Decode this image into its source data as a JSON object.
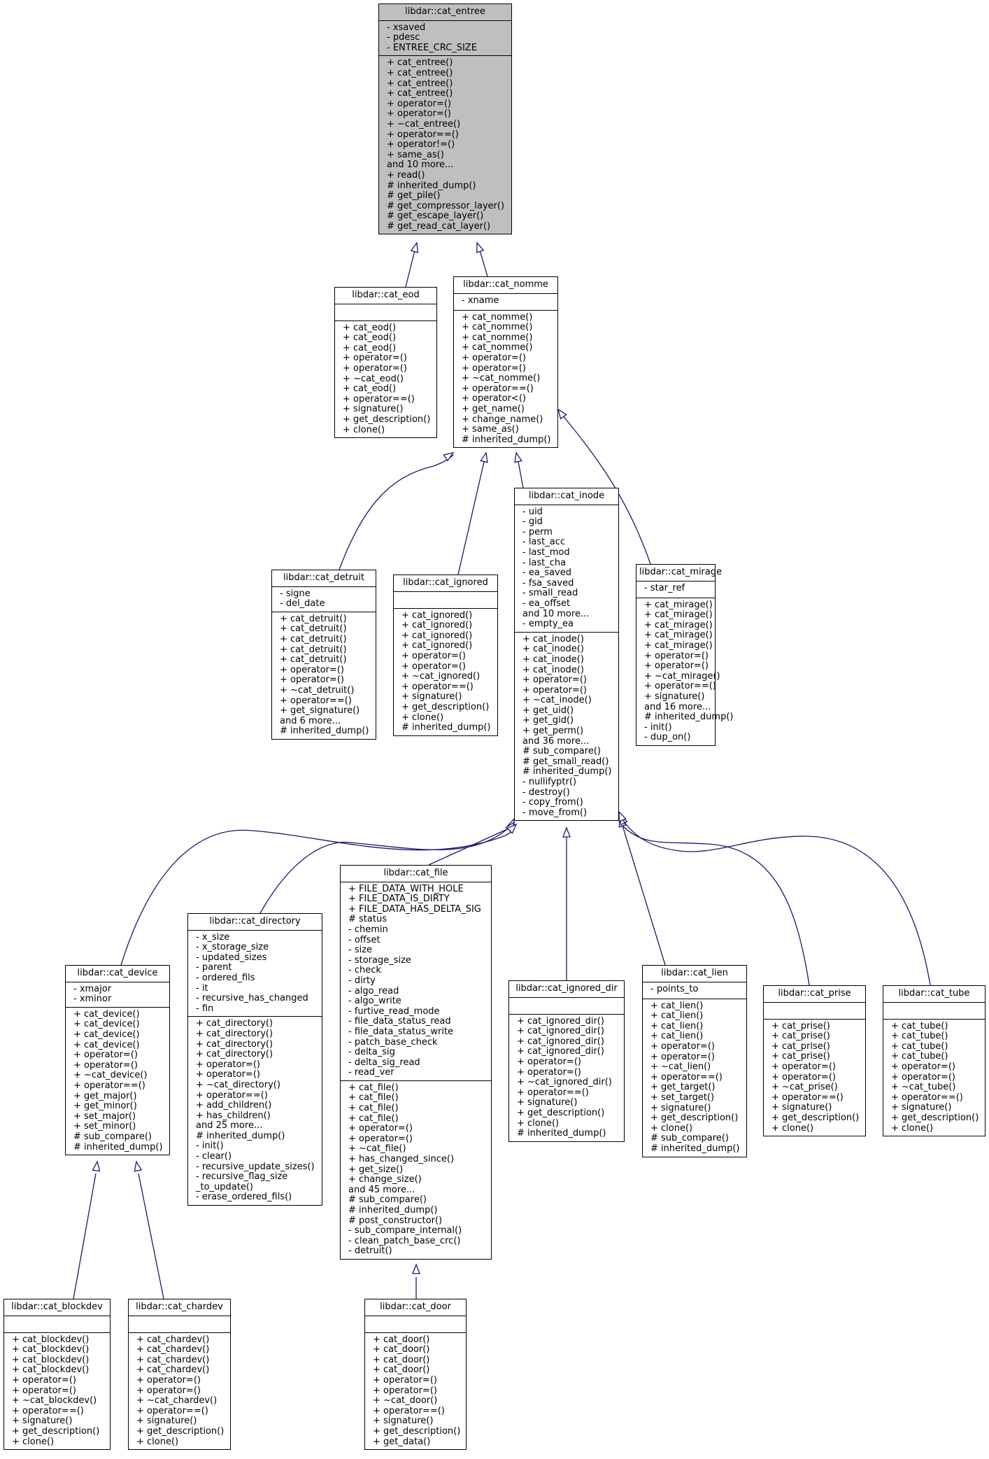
{
  "diagram": {
    "type": "class-inheritance",
    "nodes": [
      {
        "id": "cat_entree",
        "title": "libdar::cat_entree",
        "highlighted": true,
        "attributes": [
          "- xsaved",
          "- pdesc",
          "- ENTREE_CRC_SIZE"
        ],
        "methods": [
          "+ cat_entree()",
          "+ cat_entree()",
          "+ cat_entree()",
          "+ cat_entree()",
          "+ operator=()",
          "+ operator=()",
          "+ ~cat_entree()",
          "+ operator==()",
          "+ operator!=()",
          "+ same_as()",
          "and 10 more...",
          "+ read()",
          "# inherited_dump()",
          "# get_pile()",
          "# get_compressor_layer()",
          "# get_escape_layer()",
          "# get_read_cat_layer()"
        ]
      },
      {
        "id": "cat_eod",
        "title": "libdar::cat_eod",
        "attributes": [],
        "methods": [
          "+ cat_eod()",
          "+ cat_eod()",
          "+ cat_eod()",
          "+ operator=()",
          "+ operator=()",
          "+ ~cat_eod()",
          "+ cat_eod()",
          "+ operator==()",
          "+ signature()",
          "+ get_description()",
          "+ clone()"
        ]
      },
      {
        "id": "cat_nomme",
        "title": "libdar::cat_nomme",
        "attributes": [
          "- xname"
        ],
        "methods": [
          "+ cat_nomme()",
          "+ cat_nomme()",
          "+ cat_nomme()",
          "+ cat_nomme()",
          "+ operator=()",
          "+ operator=()",
          "+ ~cat_nomme()",
          "+ operator==()",
          "+ operator<()",
          "+ get_name()",
          "+ change_name()",
          "+ same_as()",
          "# inherited_dump()"
        ]
      },
      {
        "id": "cat_detruit",
        "title": "libdar::cat_detruit",
        "attributes": [
          "- signe",
          "- del_date"
        ],
        "methods": [
          "+ cat_detruit()",
          "+ cat_detruit()",
          "+ cat_detruit()",
          "+ cat_detruit()",
          "+ cat_detruit()",
          "+ operator=()",
          "+ operator=()",
          "+ ~cat_detruit()",
          "+ operator==()",
          "+ get_signature()",
          "and 6 more...",
          "# inherited_dump()"
        ]
      },
      {
        "id": "cat_ignored",
        "title": "libdar::cat_ignored",
        "attributes": [],
        "methods": [
          "+ cat_ignored()",
          "+ cat_ignored()",
          "+ cat_ignored()",
          "+ cat_ignored()",
          "+ operator=()",
          "+ operator=()",
          "+ ~cat_ignored()",
          "+ operator==()",
          "+ signature()",
          "+ get_description()",
          "+ clone()",
          "# inherited_dump()"
        ]
      },
      {
        "id": "cat_inode",
        "title": "libdar::cat_inode",
        "attributes": [
          "- uid",
          "- gid",
          "- perm",
          "- last_acc",
          "- last_mod",
          "- last_cha",
          "- ea_saved",
          "- fsa_saved",
          "- small_read",
          "- ea_offset",
          "and 10 more...",
          "- empty_ea"
        ],
        "methods": [
          "+ cat_inode()",
          "+ cat_inode()",
          "+ cat_inode()",
          "+ cat_inode()",
          "+ operator=()",
          "+ operator=()",
          "+ ~cat_inode()",
          "+ get_uid()",
          "+ get_gid()",
          "+ get_perm()",
          "and 36 more...",
          "# sub_compare()",
          "# get_small_read()",
          "# inherited_dump()",
          "- nullifyptr()",
          "- destroy()",
          "- copy_from()",
          "- move_from()"
        ]
      },
      {
        "id": "cat_mirage",
        "title": "libdar::cat_mirage",
        "attributes": [
          "- star_ref"
        ],
        "methods": [
          "+ cat_mirage()",
          "+ cat_mirage()",
          "+ cat_mirage()",
          "+ cat_mirage()",
          "+ cat_mirage()",
          "+ operator=()",
          "+ operator=()",
          "+ ~cat_mirage()",
          "+ operator==()",
          "+ signature()",
          "and 16 more...",
          "# inherited_dump()",
          "- init()",
          "- dup_on()"
        ]
      },
      {
        "id": "cat_device",
        "title": "libdar::cat_device",
        "attributes": [
          "- xmajor",
          "- xminor"
        ],
        "methods": [
          "+ cat_device()",
          "+ cat_device()",
          "+ cat_device()",
          "+ cat_device()",
          "+ operator=()",
          "+ operator=()",
          "+ ~cat_device()",
          "+ operator==()",
          "+ get_major()",
          "+ get_minor()",
          "+ set_major()",
          "+ set_minor()",
          "# sub_compare()",
          "# inherited_dump()"
        ]
      },
      {
        "id": "cat_directory",
        "title": "libdar::cat_directory",
        "attributes": [
          "- x_size",
          "- x_storage_size",
          "- updated_sizes",
          "- parent",
          "- ordered_fils",
          "- it",
          "- recursive_has_changed",
          "- fin"
        ],
        "methods": [
          "+ cat_directory()",
          "+ cat_directory()",
          "+ cat_directory()",
          "+ cat_directory()",
          "+ operator=()",
          "+ operator=()",
          "+ ~cat_directory()",
          "+ operator==()",
          "+ add_children()",
          "+ has_children()",
          "and 25 more...",
          "# inherited_dump()",
          "- init()",
          "- clear()",
          "- recursive_update_sizes()",
          "- recursive_flag_size",
          "_to_update()",
          "- erase_ordered_fils()"
        ]
      },
      {
        "id": "cat_file",
        "title": "libdar::cat_file",
        "attributes": [
          "+ FILE_DATA_WITH_HOLE",
          "+ FILE_DATA_IS_DIRTY",
          "+ FILE_DATA_HAS_DELTA_SIG",
          "# status",
          "- chemin",
          "- offset",
          "- size",
          "- storage_size",
          "- check",
          "- dirty",
          "- algo_read",
          "- algo_write",
          "- furtive_read_mode",
          "- file_data_status_read",
          "- file_data_status_write",
          "- patch_base_check",
          "- delta_sig",
          "- delta_sig_read",
          "- read_ver"
        ],
        "methods": [
          "+ cat_file()",
          "+ cat_file()",
          "+ cat_file()",
          "+ cat_file()",
          "+ operator=()",
          "+ operator=()",
          "+ ~cat_file()",
          "+ has_changed_since()",
          "+ get_size()",
          "+ change_size()",
          "and 45 more...",
          "# sub_compare()",
          "# inherited_dump()",
          "# post_constructor()",
          "- sub_compare_internal()",
          "- clean_patch_base_crc()",
          "- detruit()"
        ]
      },
      {
        "id": "cat_ignored_dir",
        "title": "libdar::cat_ignored_dir",
        "attributes": [],
        "methods": [
          "+ cat_ignored_dir()",
          "+ cat_ignored_dir()",
          "+ cat_ignored_dir()",
          "+ cat_ignored_dir()",
          "+ operator=()",
          "+ operator=()",
          "+ ~cat_ignored_dir()",
          "+ operator==()",
          "+ signature()",
          "+ get_description()",
          "+ clone()",
          "# inherited_dump()"
        ]
      },
      {
        "id": "cat_lien",
        "title": "libdar::cat_lien",
        "attributes": [
          "- points_to"
        ],
        "methods": [
          "+ cat_lien()",
          "+ cat_lien()",
          "+ cat_lien()",
          "+ cat_lien()",
          "+ operator=()",
          "+ operator=()",
          "+ ~cat_lien()",
          "+ operator==()",
          "+ get_target()",
          "+ set_target()",
          "+ signature()",
          "+ get_description()",
          "+ clone()",
          "# sub_compare()",
          "# inherited_dump()"
        ]
      },
      {
        "id": "cat_prise",
        "title": "libdar::cat_prise",
        "attributes": [],
        "methods": [
          "+ cat_prise()",
          "+ cat_prise()",
          "+ cat_prise()",
          "+ cat_prise()",
          "+ operator=()",
          "+ operator=()",
          "+ ~cat_prise()",
          "+ operator==()",
          "+ signature()",
          "+ get_description()",
          "+ clone()"
        ]
      },
      {
        "id": "cat_tube",
        "title": "libdar::cat_tube",
        "attributes": [],
        "methods": [
          "+ cat_tube()",
          "+ cat_tube()",
          "+ cat_tube()",
          "+ cat_tube()",
          "+ operator=()",
          "+ operator=()",
          "+ ~cat_tube()",
          "+ operator==()",
          "+ signature()",
          "+ get_description()",
          "+ clone()"
        ]
      },
      {
        "id": "cat_blockdev",
        "title": "libdar::cat_blockdev",
        "attributes": [],
        "methods": [
          "+ cat_blockdev()",
          "+ cat_blockdev()",
          "+ cat_blockdev()",
          "+ cat_blockdev()",
          "+ operator=()",
          "+ operator=()",
          "+ ~cat_blockdev()",
          "+ operator==()",
          "+ signature()",
          "+ get_description()",
          "+ clone()"
        ]
      },
      {
        "id": "cat_chardev",
        "title": "libdar::cat_chardev",
        "attributes": [],
        "methods": [
          "+ cat_chardev()",
          "+ cat_chardev()",
          "+ cat_chardev()",
          "+ cat_chardev()",
          "+ operator=()",
          "+ operator=()",
          "+ ~cat_chardev()",
          "+ operator==()",
          "+ signature()",
          "+ get_description()",
          "+ clone()"
        ]
      },
      {
        "id": "cat_door",
        "title": "libdar::cat_door",
        "attributes": [],
        "methods": [
          "+ cat_door()",
          "+ cat_door()",
          "+ cat_door()",
          "+ cat_door()",
          "+ operator=()",
          "+ operator=()",
          "+ ~cat_door()",
          "+ operator==()",
          "+ signature()",
          "+ get_description()",
          "+ get_data()"
        ]
      }
    ],
    "edges": [
      {
        "from": "cat_eod",
        "to": "cat_entree"
      },
      {
        "from": "cat_nomme",
        "to": "cat_entree"
      },
      {
        "from": "cat_detruit",
        "to": "cat_nomme"
      },
      {
        "from": "cat_ignored",
        "to": "cat_nomme"
      },
      {
        "from": "cat_inode",
        "to": "cat_nomme"
      },
      {
        "from": "cat_mirage",
        "to": "cat_nomme"
      },
      {
        "from": "cat_device",
        "to": "cat_inode"
      },
      {
        "from": "cat_directory",
        "to": "cat_inode"
      },
      {
        "from": "cat_file",
        "to": "cat_inode"
      },
      {
        "from": "cat_ignored_dir",
        "to": "cat_inode"
      },
      {
        "from": "cat_lien",
        "to": "cat_inode"
      },
      {
        "from": "cat_prise",
        "to": "cat_inode"
      },
      {
        "from": "cat_tube",
        "to": "cat_inode"
      },
      {
        "from": "cat_blockdev",
        "to": "cat_device"
      },
      {
        "from": "cat_chardev",
        "to": "cat_device"
      },
      {
        "from": "cat_door",
        "to": "cat_file"
      }
    ],
    "colors": {
      "edge": "#191970",
      "highlight_fill": "#bfbfbf",
      "border": "#000000"
    }
  }
}
